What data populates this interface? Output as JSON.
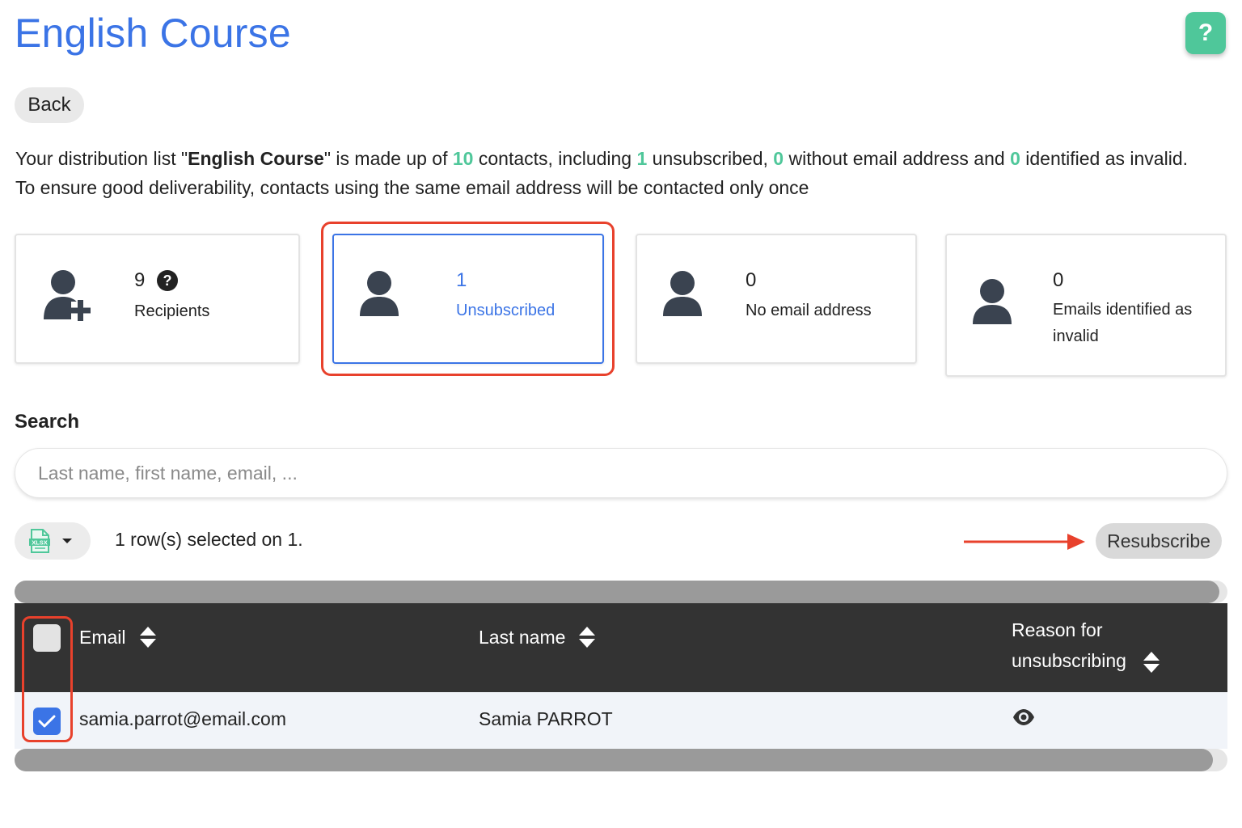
{
  "header": {
    "title": "English Course",
    "help_label": "?"
  },
  "back_label": "Back",
  "summary": {
    "line1_prefix": "Your distribution list \"",
    "list_name": "English Course",
    "line1_a": "\" is made up of ",
    "contacts_count": "10",
    "line1_b": " contacts, including ",
    "unsubscribed_count": "1",
    "line1_c": " unsubscribed, ",
    "no_email_count": "0",
    "line1_d": " without email address and ",
    "invalid_count": "0",
    "line1_e": " identified as invalid.",
    "line2": "To ensure good deliverability, contacts using the same email address will be contacted only once"
  },
  "cards": [
    {
      "count": "9",
      "label": "Recipients",
      "icon": "user-plus-icon",
      "has_help": true
    },
    {
      "count": "1",
      "label": "Unsubscribed",
      "icon": "user-icon",
      "selected": true
    },
    {
      "count": "0",
      "label": "No email address",
      "icon": "user-icon"
    },
    {
      "count": "0",
      "label": "Emails identified as invalid",
      "icon": "user-icon"
    }
  ],
  "search": {
    "label": "Search",
    "placeholder": "Last name, first name, email, ..."
  },
  "toolbar": {
    "export_icon": "xlsx-file-icon",
    "selection_status": "1 row(s) selected on 1.",
    "resubscribe_label": "Resubscribe"
  },
  "table": {
    "columns": [
      "Email",
      "Last name",
      "Reason for unsubscribing"
    ],
    "rows": [
      {
        "email": "samia.parrot@email.com",
        "last_name": "Samia PARROT",
        "selected": true,
        "reason_icon": "eye-icon"
      }
    ]
  },
  "colors": {
    "accent": "#3b74e6",
    "success": "#4fc79a",
    "annotation": "#e8412c",
    "table_header": "#333333"
  }
}
